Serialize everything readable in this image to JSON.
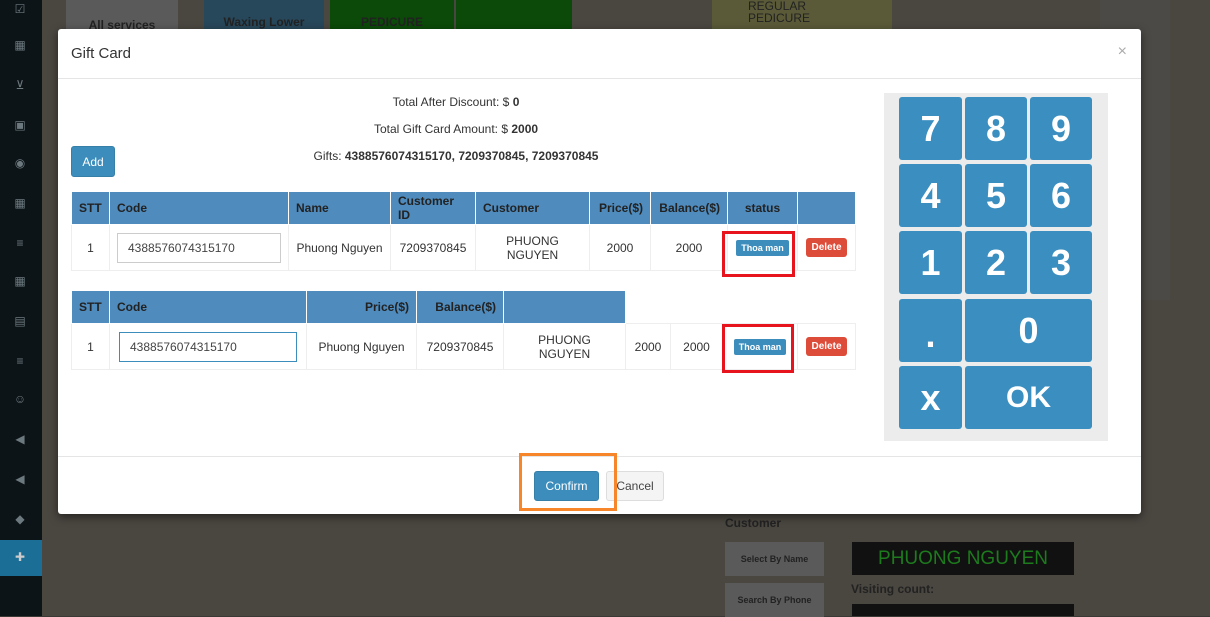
{
  "background": {
    "tiles": [
      "All services",
      "Waxing Lower",
      "PEDICURE",
      "REGULAR",
      "PEDICURE"
    ],
    "customer_label": "Customer",
    "select_by_name": "Select By Name",
    "search_by_phone": "Search By Phone",
    "customer_name": "PHUONG NGUYEN",
    "visiting_count": "Visiting count:"
  },
  "modal": {
    "title": "Gift Card",
    "close": "×",
    "total_after_discount_label": "Total After Discount: $ ",
    "total_after_discount": "0",
    "total_gift_label": "Total Gift Card Amount: $ ",
    "total_gift": "2000",
    "gifts_label": "Gifts: ",
    "gifts": "4388576074315170, 7209370845, 7209370845",
    "add_label": "Add",
    "table1": {
      "headers": [
        "STT",
        "Code",
        "Name",
        "Customer ID",
        "Customer",
        "Price($)",
        "Balance($)",
        "status",
        ""
      ],
      "row": {
        "stt": "1",
        "code": "4388576074315170",
        "name": "Phuong Nguyen",
        "customer_id": "7209370845",
        "customer": "PHUONG NGUYEN",
        "price": "2000",
        "balance": "2000",
        "status": "Thoa man",
        "delete": "Delete"
      }
    },
    "table2": {
      "headers": [
        "STT",
        "Code",
        "Price($)",
        "Balance($)",
        ""
      ],
      "row": {
        "stt": "1",
        "code": "4388576074315170",
        "name": "Phuong Nguyen",
        "customer_id": "7209370845",
        "customer": "PHUONG NGUYEN",
        "price": "2000",
        "balance": "2000",
        "status": "Thoa man",
        "delete": "Delete"
      }
    },
    "keypad": [
      "7",
      "8",
      "9",
      "4",
      "5",
      "6",
      "1",
      "2",
      "3",
      ".",
      "0",
      "x",
      "OK"
    ],
    "confirm_label": "Confirm",
    "cancel_label": "Cancel"
  },
  "colors": {
    "primary": "#3c8dbc",
    "danger": "#dd4b39",
    "highlight_red": "#e8141d",
    "highlight_orange": "#f7862b"
  }
}
